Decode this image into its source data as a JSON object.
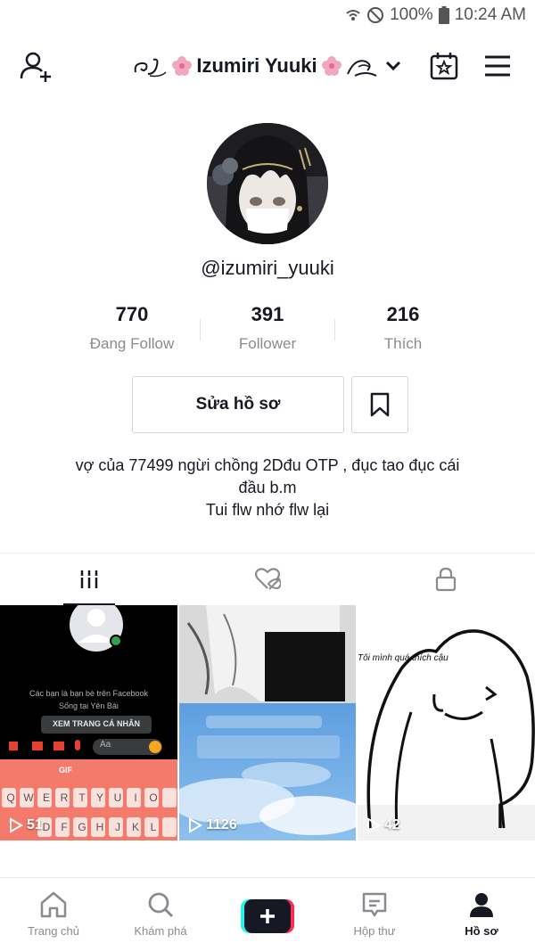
{
  "status_bar": {
    "battery": "100%",
    "time": "10:24 AM"
  },
  "header": {
    "account_name": "Izumiri Yuuki",
    "icons": [
      "add-user-icon",
      "chevron-down-icon",
      "calendar-star-icon",
      "hamburger-menu-icon"
    ]
  },
  "profile": {
    "username": "@izumiri_yuuki",
    "stats": [
      {
        "value": "770",
        "label": "Đang Follow"
      },
      {
        "value": "391",
        "label": "Follower"
      },
      {
        "value": "216",
        "label": "Thích"
      }
    ],
    "edit_button": "Sửa hồ sơ",
    "bio": {
      "line1": "vợ của 77499 ngừi chồng 2Dđu OTP , đục tao đục cái",
      "line2": "đầu b.m",
      "line3": "Tui flw nhớ flw lại"
    }
  },
  "tabs": {
    "icons": [
      "grid-icon",
      "liked-hidden-icon",
      "lock-icon"
    ],
    "active_index": 0
  },
  "videos": [
    {
      "views": "51",
      "overlay": {
        "suggest_line1": "Các bạn là bạn bè trên Facebook",
        "suggest_line2": "Sống tại Yên Bái",
        "button": "XEM TRANG CÁ NHÂN",
        "input_placeholder": "Aa",
        "gif": "GIF",
        "kb_row1": [
          "Q",
          "W",
          "E",
          "R",
          "T",
          "Y",
          "U",
          "I",
          "O"
        ],
        "kb_row2": [
          "D",
          "F",
          "G",
          "H",
          "J",
          "K",
          "L"
        ]
      }
    },
    {
      "views": "1126"
    },
    {
      "views": "42",
      "caption": "Tôi mình quá thích cậu"
    }
  ],
  "bottom_nav": [
    {
      "label": "Trang chủ",
      "icon": "home-icon"
    },
    {
      "label": "Khám phá",
      "icon": "search-icon"
    },
    {
      "label": "",
      "icon": "plus-icon"
    },
    {
      "label": "Hộp thư",
      "icon": "inbox-icon"
    },
    {
      "label": "Hồ sơ",
      "icon": "profile-icon"
    }
  ],
  "colors": {
    "text_primary": "#161823",
    "text_secondary": "#8a8b91",
    "tiktok_cyan": "#25f4ee",
    "tiktok_red": "#fe2c55",
    "border": "#d6d6d8"
  }
}
